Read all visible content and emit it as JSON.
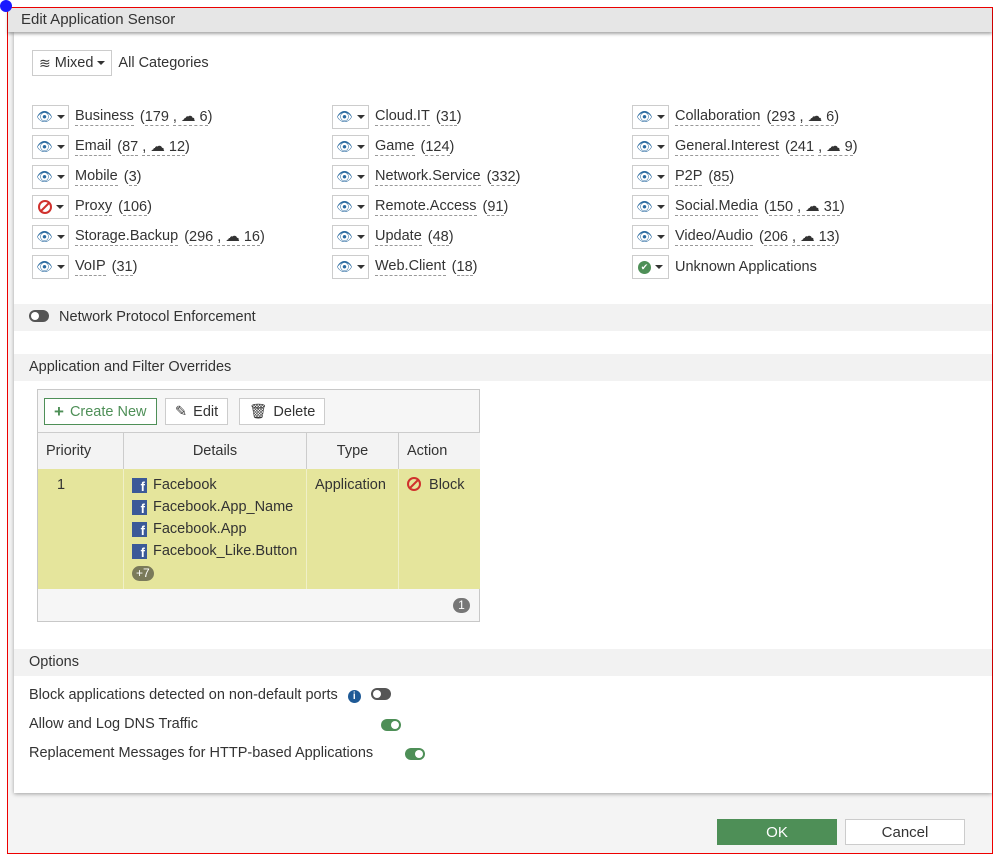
{
  "title": "Edit Application Sensor",
  "category_selector": {
    "mode": "Mixed",
    "label": "All Categories"
  },
  "categories": [
    {
      "name": "Business",
      "count": "179",
      "cloud": "6",
      "action": "monitor"
    },
    {
      "name": "Cloud.IT",
      "count": "31",
      "action": "monitor"
    },
    {
      "name": "Collaboration",
      "count": "293",
      "cloud": "6",
      "action": "monitor"
    },
    {
      "name": "Email",
      "count": "87",
      "cloud": "12",
      "action": "monitor"
    },
    {
      "name": "Game",
      "count": "124",
      "action": "monitor"
    },
    {
      "name": "General.Interest",
      "count": "241",
      "cloud": "9",
      "action": "monitor"
    },
    {
      "name": "Mobile",
      "count": "3",
      "action": "monitor"
    },
    {
      "name": "Network.Service",
      "count": "332",
      "action": "monitor"
    },
    {
      "name": "P2P",
      "count": "85",
      "action": "monitor"
    },
    {
      "name": "Proxy",
      "count": "106",
      "action": "block"
    },
    {
      "name": "Remote.Access",
      "count": "91",
      "action": "monitor"
    },
    {
      "name": "Social.Media",
      "count": "150",
      "cloud": "31",
      "action": "monitor"
    },
    {
      "name": "Storage.Backup",
      "count": "296",
      "cloud": "16",
      "action": "monitor"
    },
    {
      "name": "Update",
      "count": "48",
      "action": "monitor"
    },
    {
      "name": "Video/Audio",
      "count": "206",
      "cloud": "13",
      "action": "monitor"
    },
    {
      "name": "VoIP",
      "count": "31",
      "action": "monitor"
    },
    {
      "name": "Web.Client",
      "count": "18",
      "action": "monitor"
    },
    {
      "name": "Unknown Applications",
      "action": "allow"
    }
  ],
  "network_protocol_enforcement": {
    "label": "Network Protocol Enforcement",
    "enabled": false
  },
  "overrides": {
    "title": "Application and Filter Overrides",
    "create_new": "Create New",
    "edit": "Edit",
    "delete": "Delete",
    "columns": [
      "Priority",
      "Details",
      "Type",
      "Action"
    ],
    "rows": [
      {
        "priority": "1",
        "details": [
          "Facebook",
          "Facebook.App_Name",
          "Facebook.App",
          "Facebook_Like.Button"
        ],
        "more": "+7",
        "type": "Application",
        "action": "Block"
      }
    ],
    "total": "1"
  },
  "options": {
    "title": "Options",
    "items": [
      {
        "label": "Block applications detected on non-default ports",
        "enabled": false,
        "info": true
      },
      {
        "label": "Allow and Log DNS Traffic",
        "enabled": true
      },
      {
        "label": "Replacement Messages for HTTP-based Applications",
        "enabled": true
      }
    ]
  },
  "footer": {
    "ok": "OK",
    "cancel": "Cancel"
  },
  "colors": {
    "accent": "#4e8f57",
    "block": "#d0312d",
    "row_highlight": "#e5e59c"
  }
}
